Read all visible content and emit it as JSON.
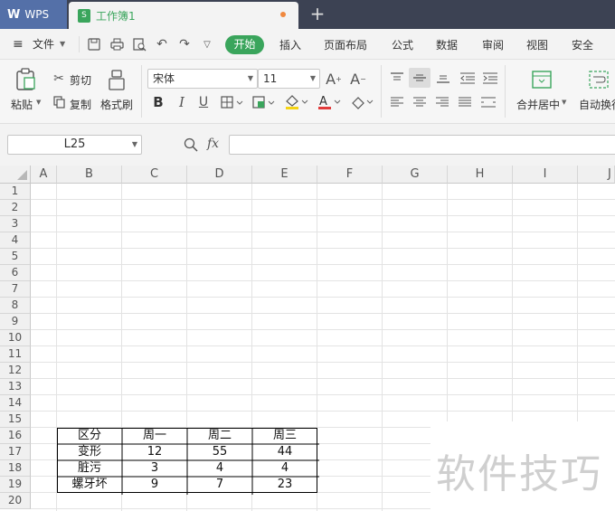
{
  "tabs": {
    "app_label": "WPS",
    "doc_label": "工作簿1",
    "add_label": "+"
  },
  "menu": {
    "file_label": "文件",
    "items": [
      "开始",
      "插入",
      "页面布局",
      "公式",
      "数据",
      "审阅",
      "视图",
      "安全"
    ],
    "active": "开始"
  },
  "ribbon": {
    "paste": "粘贴",
    "cut": "剪切",
    "copy": "复制",
    "format_painter": "格式刷",
    "font_name": "宋体",
    "font_size": "11",
    "merge_center": "合并居中",
    "wrap_text": "自动换行"
  },
  "formula_bar": {
    "name_box": "L25",
    "fx_label": "fx",
    "formula": ""
  },
  "columns": [
    "A",
    "B",
    "C",
    "D",
    "E",
    "F",
    "G",
    "H",
    "I",
    "J"
  ],
  "rows": [
    "1",
    "2",
    "3",
    "4",
    "5",
    "6",
    "7",
    "8",
    "9",
    "10",
    "11",
    "12",
    "13",
    "14",
    "15",
    "16",
    "17",
    "18",
    "19",
    "20"
  ],
  "table": {
    "headers": [
      "区分",
      "周一",
      "周二",
      "周三"
    ],
    "rows": [
      [
        "变形",
        "12",
        "55",
        "44"
      ],
      [
        "脏污",
        "3",
        "4",
        "4"
      ],
      [
        "螺牙坏",
        "9",
        "7",
        "23"
      ]
    ]
  },
  "watermark": "软件技巧",
  "colors": {
    "tabbar_bg": "#3c4253",
    "wps_tab_bg": "#5470a8",
    "start_pill": "#3aa55c",
    "doc_dot": "#f0883e"
  }
}
